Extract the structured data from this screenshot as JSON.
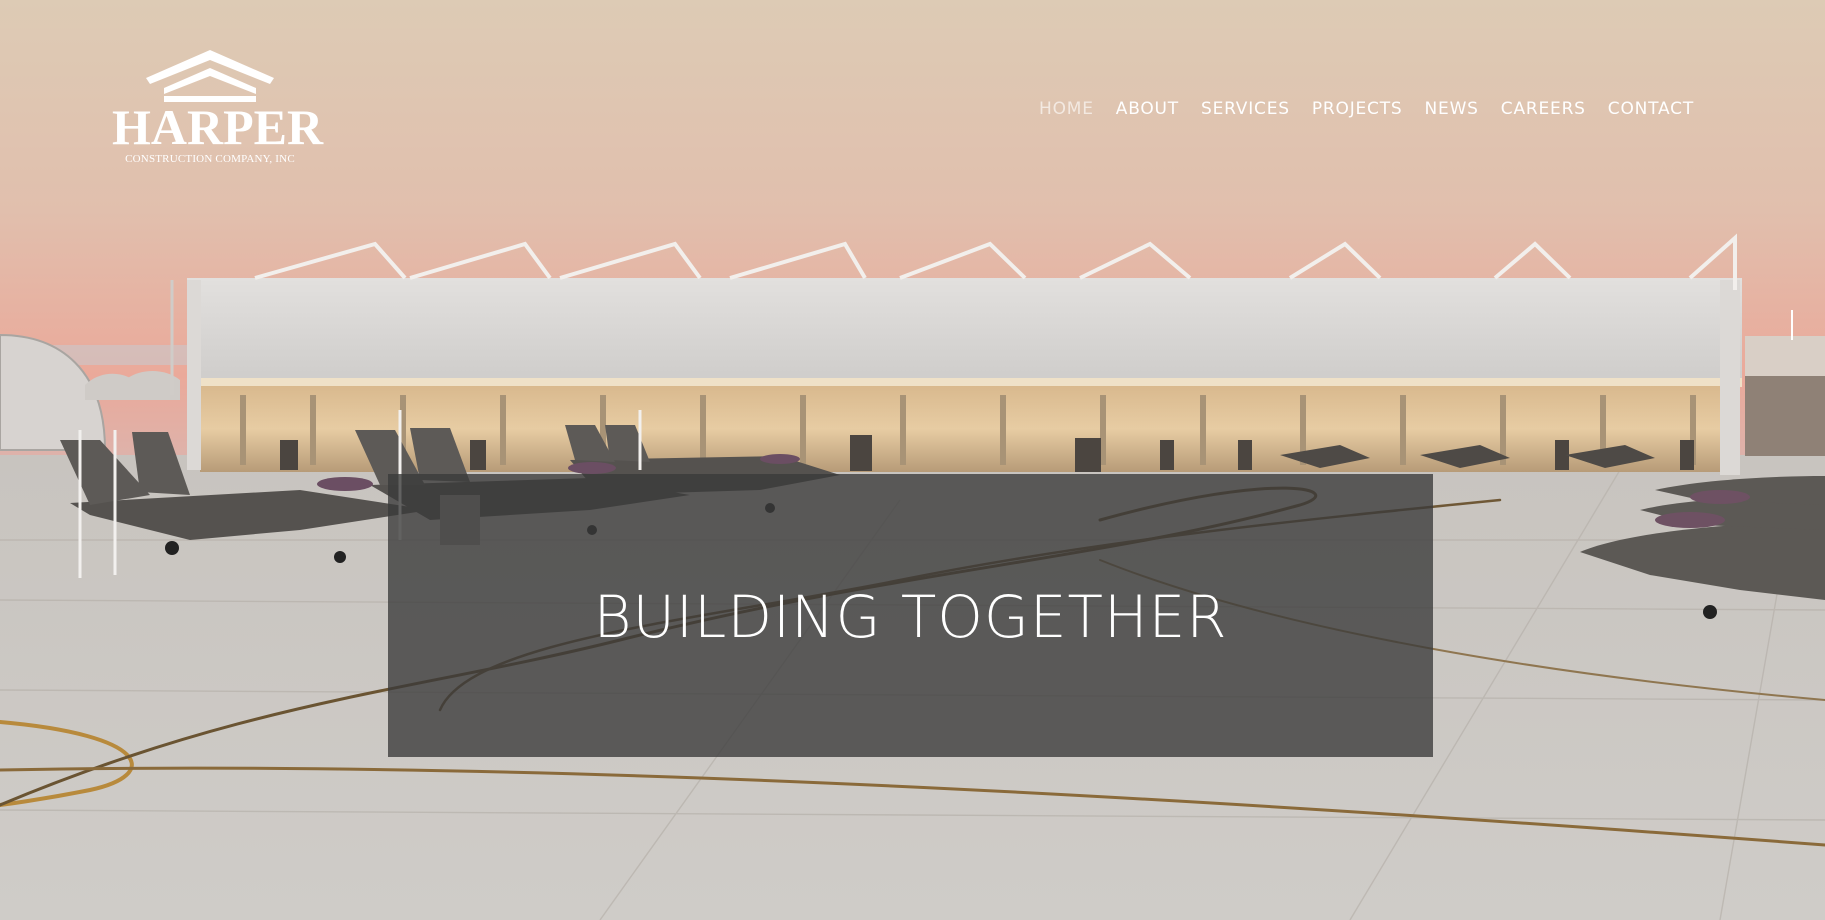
{
  "brand": {
    "name": "HARPER",
    "tagline": "CONSTRUCTION COMPANY, INC"
  },
  "nav": {
    "items": [
      {
        "label": "HOME",
        "active": true
      },
      {
        "label": "ABOUT",
        "active": false
      },
      {
        "label": "SERVICES",
        "active": false
      },
      {
        "label": "PROJECTS",
        "active": false
      },
      {
        "label": "NEWS",
        "active": false
      },
      {
        "label": "CAREERS",
        "active": false
      },
      {
        "label": "CONTACT",
        "active": false
      }
    ]
  },
  "hero": {
    "title": "BUILDING TOGETHER",
    "image": "aircraft-hangar-with-fighter-jets-at-dusk"
  },
  "colors": {
    "overlay": "#3a3a3a",
    "nav_text": "#ffffff",
    "nav_active": "#d9d4cf",
    "sky_top": "#ddcbb6",
    "sky_horizon": "#e9a697",
    "tarmac": "#c9c5c0"
  }
}
